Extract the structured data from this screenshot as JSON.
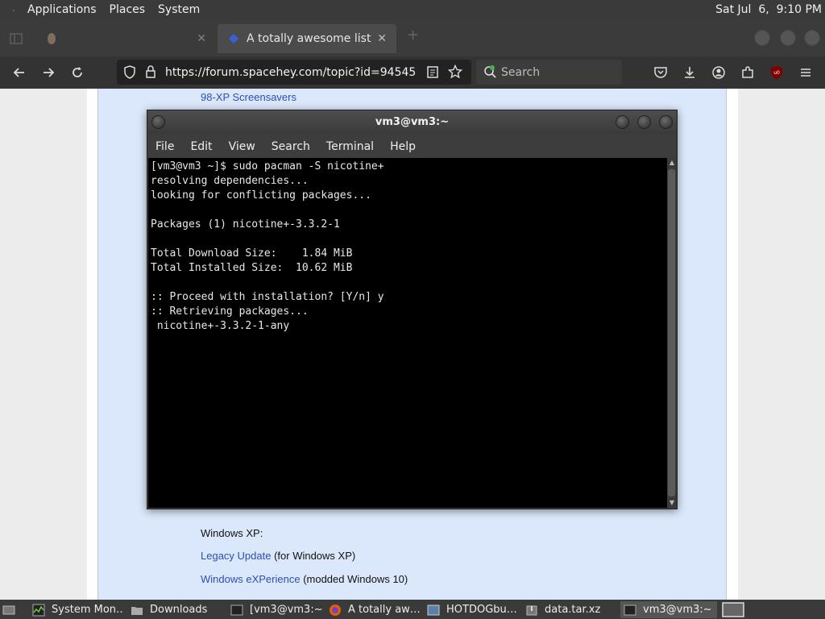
{
  "top_panel": {
    "menu": [
      "Applications",
      "Places",
      "System"
    ],
    "clock": "Sat Jul  6,  9:10 PM"
  },
  "browser": {
    "tabs": [
      {
        "title": "",
        "active": false
      },
      {
        "title": "A totally awesome list of \"ol",
        "active": true
      }
    ],
    "new_tab": "+",
    "url": "https://forum.spacehey.com/topic?id=94545",
    "search_placeholder": "Search"
  },
  "page": {
    "link_top": "98-XP Screensavers",
    "windows_xp_heading": "Windows XP:",
    "legacy_update_link": "Legacy Update",
    "legacy_update_suffix": "(for Windows XP)",
    "windows_experience_link": "Windows eXPerience",
    "windows_experience_suffix": "(modded Windows 10)"
  },
  "terminal": {
    "title": "vm3@vm3:~",
    "menu": [
      "File",
      "Edit",
      "View",
      "Search",
      "Terminal",
      "Help"
    ],
    "lines": [
      "[vm3@vm3 ~]$ sudo pacman -S nicotine+",
      "resolving dependencies...",
      "looking for conflicting packages...",
      "",
      "Packages (1) nicotine+-3.3.2-1",
      "",
      "Total Download Size:    1.84 MiB",
      "Total Installed Size:  10.62 MiB",
      "",
      ":: Proceed with installation? [Y/n] y",
      ":: Retrieving packages...",
      " nicotine+-3.3.2-1-any"
    ]
  },
  "taskbar": {
    "items": [
      {
        "label": "System Mon…",
        "icon": "system-monitor-icon",
        "active": false
      },
      {
        "label": "Downloads",
        "icon": "folder-icon",
        "active": false
      },
      {
        "label": "[vm3@vm3:~]",
        "icon": "terminal-icon",
        "active": false
      },
      {
        "label": "A totally aw…",
        "icon": "firefox-icon",
        "active": false
      },
      {
        "label": "HOTDOGbu…",
        "icon": "app-icon",
        "active": false
      },
      {
        "label": "data.tar.xz",
        "icon": "archive-icon",
        "active": false
      },
      {
        "label": "vm3@vm3:~",
        "icon": "terminal-icon",
        "active": true
      }
    ]
  },
  "colors": {
    "panel": "#3a3a3a",
    "terminal_bg": "#000000",
    "link": "#2a4fb5",
    "content_bg": "#dbe8fb"
  }
}
